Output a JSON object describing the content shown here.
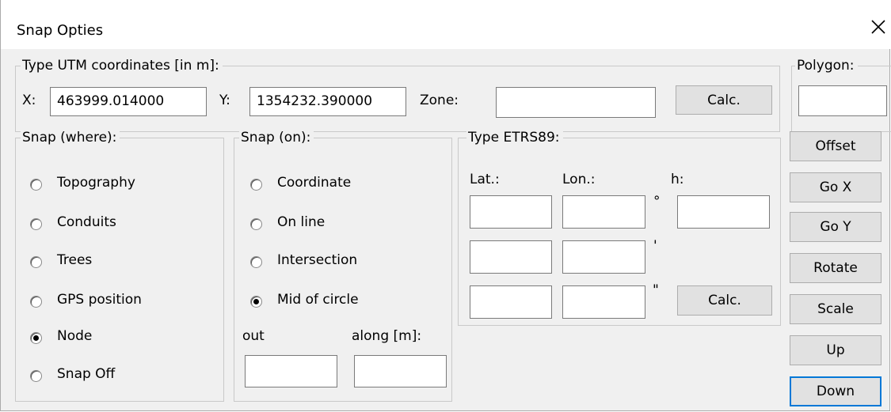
{
  "window": {
    "title": "Snap Opties"
  },
  "utm": {
    "legend": "Type UTM coordinates [in m]:",
    "x_label": "X:",
    "x_value": "463999.014000",
    "y_label": "Y:",
    "y_value": "1354232.390000",
    "zone_label": "Zone:",
    "zone_value": "",
    "calc_label": "Calc."
  },
  "polygon": {
    "legend": "Polygon:",
    "value": ""
  },
  "snap_where": {
    "legend": "Snap (where):",
    "options": [
      {
        "label": "Topography",
        "selected": false
      },
      {
        "label": "Conduits",
        "selected": false
      },
      {
        "label": "Trees",
        "selected": false
      },
      {
        "label": "GPS position",
        "selected": false
      },
      {
        "label": "Node",
        "selected": true
      },
      {
        "label": "Snap Off",
        "selected": false
      }
    ]
  },
  "snap_on": {
    "legend": "Snap (on):",
    "options": [
      {
        "label": "Coordinate",
        "selected": false
      },
      {
        "label": "On line",
        "selected": false
      },
      {
        "label": "Intersection",
        "selected": false
      },
      {
        "label": "Mid of circle",
        "selected": true
      }
    ],
    "out_label": "out",
    "along_label": "along [m]:",
    "out_value": "",
    "along_value": ""
  },
  "etrs": {
    "legend": "Type ETRS89:",
    "lat_label": "Lat.:",
    "lon_label": "Lon.:",
    "h_label": "h:",
    "deg_symbol": "°",
    "min_symbol": "'",
    "sec_symbol": "\"",
    "calc_label": "Calc."
  },
  "side_buttons": [
    "Offset",
    "Go X",
    "Go Y",
    "Rotate",
    "Scale",
    "Up",
    "Down"
  ]
}
